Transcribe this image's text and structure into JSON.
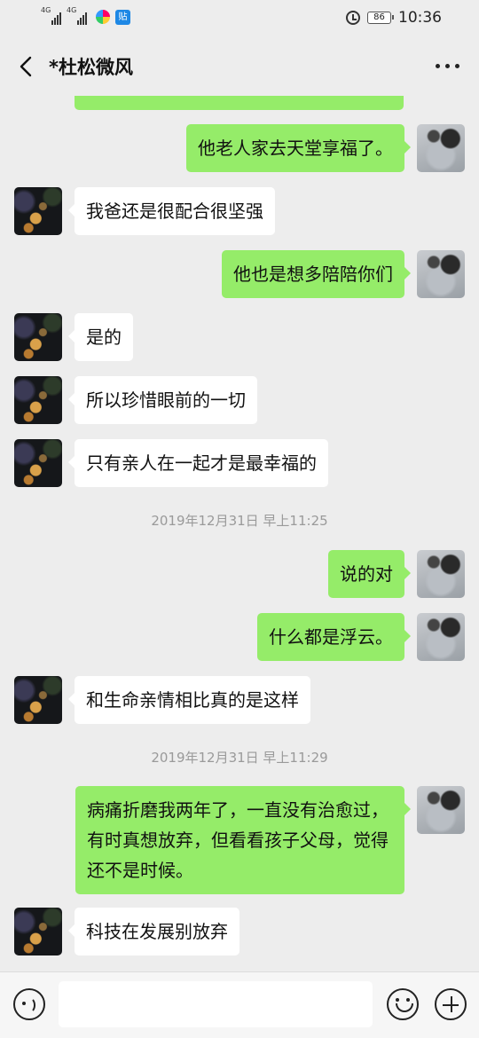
{
  "status_bar": {
    "signal1_label": "4G",
    "signal2_label": "4G",
    "app_badge2": "贴",
    "battery": "86",
    "time": "10:36"
  },
  "header": {
    "title": "*杜松微风"
  },
  "messages": [
    {
      "type": "text",
      "side": "right",
      "text": "他老人家去天堂享福了。"
    },
    {
      "type": "text",
      "side": "left",
      "text": "我爸还是很配合很坚强"
    },
    {
      "type": "text",
      "side": "right",
      "text": "他也是想多陪陪你们"
    },
    {
      "type": "text",
      "side": "left",
      "text": "是的"
    },
    {
      "type": "text",
      "side": "left",
      "text": "所以珍惜眼前的一切"
    },
    {
      "type": "text",
      "side": "left",
      "text": "只有亲人在一起才是最幸福的"
    },
    {
      "type": "time",
      "text": "2019年12月31日 早上11:25"
    },
    {
      "type": "text",
      "side": "right",
      "text": "说的对"
    },
    {
      "type": "text",
      "side": "right",
      "text": "什么都是浮云。"
    },
    {
      "type": "text",
      "side": "left",
      "text": "和生命亲情相比真的是这样"
    },
    {
      "type": "time",
      "text": "2019年12月31日 早上11:29"
    },
    {
      "type": "text",
      "side": "right",
      "text": "病痛折磨我两年了，一直没有治愈过，有时真想放弃，但看看孩子父母，觉得还不是时候。"
    },
    {
      "type": "text",
      "side": "left",
      "text": "科技在发展别放弃"
    }
  ],
  "input": {
    "value": ""
  },
  "colors": {
    "background": "#ededed",
    "outgoing_bubble": "#95ec69",
    "incoming_bubble": "#ffffff"
  }
}
